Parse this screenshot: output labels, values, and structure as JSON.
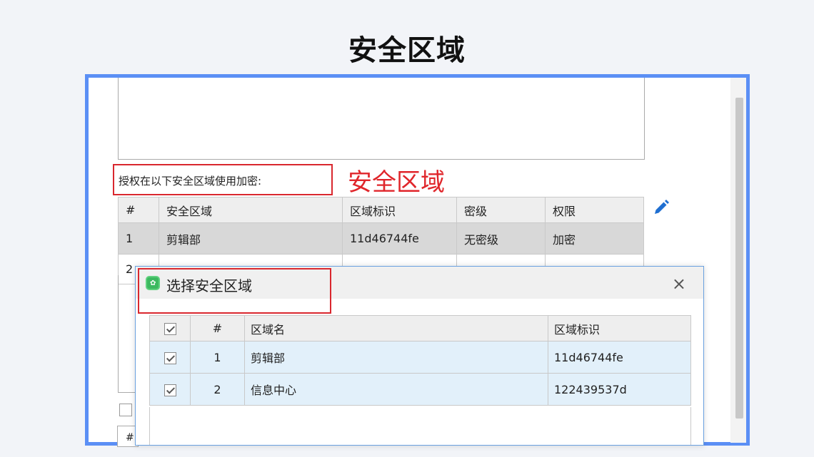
{
  "title": "安全区域",
  "form": {
    "auth_label": "授权在以下安全区域使用加密:",
    "annotation": "安全区域"
  },
  "zones_table": {
    "headers": [
      "#",
      "安全区域",
      "区域标识",
      "密级",
      "权限"
    ],
    "rows": [
      {
        "num": "1",
        "zone": "剪辑部",
        "id": "11d46744fe",
        "level": "无密级",
        "perm": "加密"
      },
      {
        "num": "2",
        "zone": "",
        "id": "",
        "level": "",
        "perm": ""
      }
    ]
  },
  "dialog": {
    "title": "选择安全区域",
    "close": "×",
    "headers": {
      "num": "#",
      "name": "区域名",
      "id": "区域标识"
    },
    "rows": [
      {
        "num": "1",
        "name": "剪辑部",
        "id": "11d46744fe"
      },
      {
        "num": "2",
        "name": "信息中心",
        "id": "122439537d"
      }
    ]
  },
  "partial_box_text": "#",
  "icons": [
    "edit-pencil-icon",
    "app-icon",
    "close-icon",
    "checkbox-icon"
  ],
  "colors": {
    "frame": "#5b8ff5",
    "annotation_red": "#e0262b",
    "pencil": "#1f6fd1",
    "row_selected": "#e2f0fa"
  }
}
